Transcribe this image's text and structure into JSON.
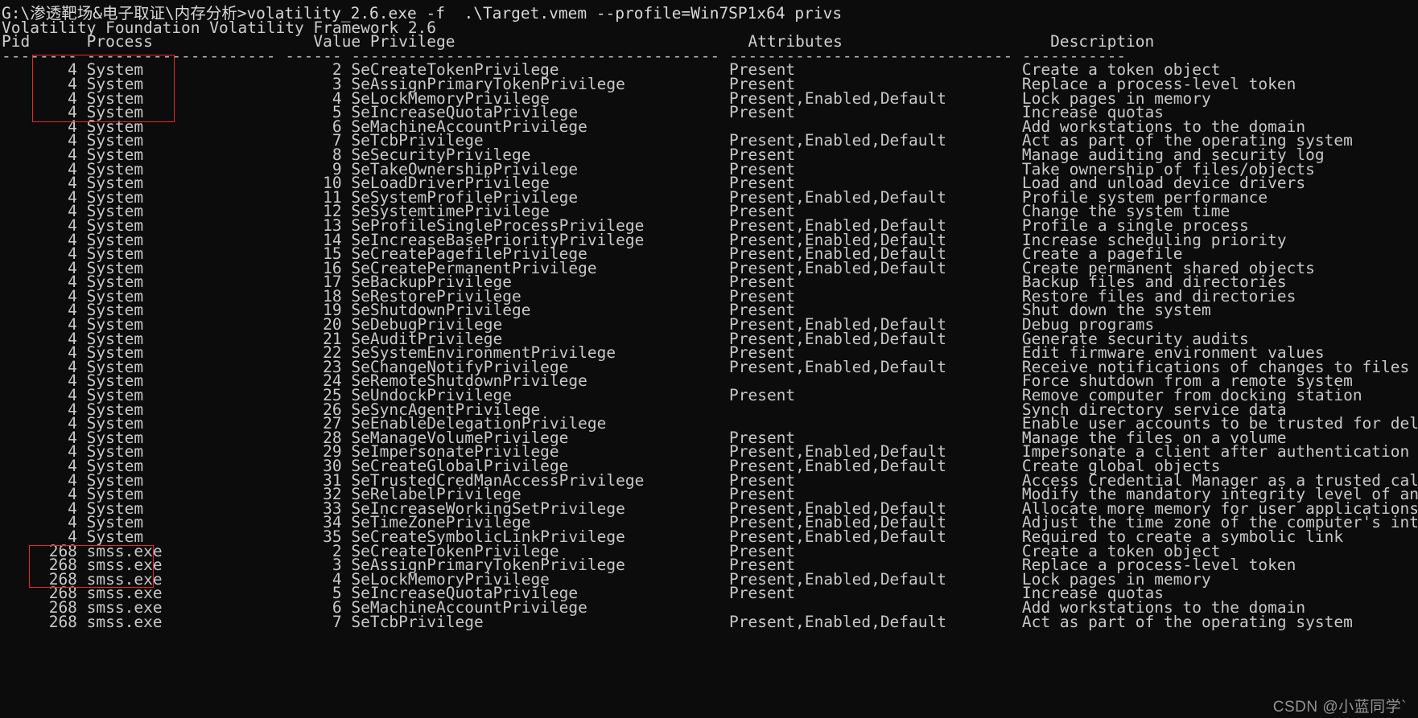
{
  "terminal": {
    "prompt_line": "G:\\渗透靶场&电子取证\\内存分析>volatility_2.6.exe -f  .\\Target.vmem --profile=Win7SP1x64 privs",
    "banner": "Volatility Foundation Volatility Framework 2.6",
    "header": "Pid      Process                 Value Privilege                               Attributes                      Description",
    "separator": "-------- -------------------- ------ --------------------------------------- ------------------------------ -----------",
    "background_color": "#0c0c0c",
    "text_color": "#cccccc",
    "annotation_color": "#e8282d",
    "watermark": "CSDN @小蓝同学`"
  },
  "columns": [
    "Pid",
    "Process",
    "Value",
    "Privilege",
    "Attributes",
    "Description"
  ],
  "rows": [
    {
      "pid": "4",
      "process": "System",
      "value": "2",
      "privilege": "SeCreateTokenPrivilege",
      "attributes": "Present",
      "description": "Create a token object"
    },
    {
      "pid": "4",
      "process": "System",
      "value": "3",
      "privilege": "SeAssignPrimaryTokenPrivilege",
      "attributes": "Present",
      "description": "Replace a process-level token"
    },
    {
      "pid": "4",
      "process": "System",
      "value": "4",
      "privilege": "SeLockMemoryPrivilege",
      "attributes": "Present,Enabled,Default",
      "description": "Lock pages in memory"
    },
    {
      "pid": "4",
      "process": "System",
      "value": "5",
      "privilege": "SeIncreaseQuotaPrivilege",
      "attributes": "Present",
      "description": "Increase quotas"
    },
    {
      "pid": "4",
      "process": "System",
      "value": "6",
      "privilege": "SeMachineAccountPrivilege",
      "attributes": "",
      "description": "Add workstations to the domain"
    },
    {
      "pid": "4",
      "process": "System",
      "value": "7",
      "privilege": "SeTcbPrivilege",
      "attributes": "Present,Enabled,Default",
      "description": "Act as part of the operating system"
    },
    {
      "pid": "4",
      "process": "System",
      "value": "8",
      "privilege": "SeSecurityPrivilege",
      "attributes": "Present",
      "description": "Manage auditing and security log"
    },
    {
      "pid": "4",
      "process": "System",
      "value": "9",
      "privilege": "SeTakeOwnershipPrivilege",
      "attributes": "Present",
      "description": "Take ownership of files/objects"
    },
    {
      "pid": "4",
      "process": "System",
      "value": "10",
      "privilege": "SeLoadDriverPrivilege",
      "attributes": "Present",
      "description": "Load and unload device drivers"
    },
    {
      "pid": "4",
      "process": "System",
      "value": "11",
      "privilege": "SeSystemProfilePrivilege",
      "attributes": "Present,Enabled,Default",
      "description": "Profile system performance"
    },
    {
      "pid": "4",
      "process": "System",
      "value": "12",
      "privilege": "SeSystemtimePrivilege",
      "attributes": "Present",
      "description": "Change the system time"
    },
    {
      "pid": "4",
      "process": "System",
      "value": "13",
      "privilege": "SeProfileSingleProcessPrivilege",
      "attributes": "Present,Enabled,Default",
      "description": "Profile a single process"
    },
    {
      "pid": "4",
      "process": "System",
      "value": "14",
      "privilege": "SeIncreaseBasePriorityPrivilege",
      "attributes": "Present,Enabled,Default",
      "description": "Increase scheduling priority"
    },
    {
      "pid": "4",
      "process": "System",
      "value": "15",
      "privilege": "SeCreatePagefilePrivilege",
      "attributes": "Present,Enabled,Default",
      "description": "Create a pagefile"
    },
    {
      "pid": "4",
      "process": "System",
      "value": "16",
      "privilege": "SeCreatePermanentPrivilege",
      "attributes": "Present,Enabled,Default",
      "description": "Create permanent shared objects"
    },
    {
      "pid": "4",
      "process": "System",
      "value": "17",
      "privilege": "SeBackupPrivilege",
      "attributes": "Present",
      "description": "Backup files and directories"
    },
    {
      "pid": "4",
      "process": "System",
      "value": "18",
      "privilege": "SeRestorePrivilege",
      "attributes": "Present",
      "description": "Restore files and directories"
    },
    {
      "pid": "4",
      "process": "System",
      "value": "19",
      "privilege": "SeShutdownPrivilege",
      "attributes": "Present",
      "description": "Shut down the system"
    },
    {
      "pid": "4",
      "process": "System",
      "value": "20",
      "privilege": "SeDebugPrivilege",
      "attributes": "Present,Enabled,Default",
      "description": "Debug programs"
    },
    {
      "pid": "4",
      "process": "System",
      "value": "21",
      "privilege": "SeAuditPrivilege",
      "attributes": "Present,Enabled,Default",
      "description": "Generate security audits"
    },
    {
      "pid": "4",
      "process": "System",
      "value": "22",
      "privilege": "SeSystemEnvironmentPrivilege",
      "attributes": "Present",
      "description": "Edit firmware environment values"
    },
    {
      "pid": "4",
      "process": "System",
      "value": "23",
      "privilege": "SeChangeNotifyPrivilege",
      "attributes": "Present,Enabled,Default",
      "description": "Receive notifications of changes to files or directories"
    },
    {
      "pid": "4",
      "process": "System",
      "value": "24",
      "privilege": "SeRemoteShutdownPrivilege",
      "attributes": "",
      "description": "Force shutdown from a remote system"
    },
    {
      "pid": "4",
      "process": "System",
      "value": "25",
      "privilege": "SeUndockPrivilege",
      "attributes": "Present",
      "description": "Remove computer from docking station"
    },
    {
      "pid": "4",
      "process": "System",
      "value": "26",
      "privilege": "SeSyncAgentPrivilege",
      "attributes": "",
      "description": "Synch directory service data"
    },
    {
      "pid": "4",
      "process": "System",
      "value": "27",
      "privilege": "SeEnableDelegationPrivilege",
      "attributes": "",
      "description": "Enable user accounts to be trusted for delegation"
    },
    {
      "pid": "4",
      "process": "System",
      "value": "28",
      "privilege": "SeManageVolumePrivilege",
      "attributes": "Present",
      "description": "Manage the files on a volume"
    },
    {
      "pid": "4",
      "process": "System",
      "value": "29",
      "privilege": "SeImpersonatePrivilege",
      "attributes": "Present,Enabled,Default",
      "description": "Impersonate a client after authentication"
    },
    {
      "pid": "4",
      "process": "System",
      "value": "30",
      "privilege": "SeCreateGlobalPrivilege",
      "attributes": "Present,Enabled,Default",
      "description": "Create global objects"
    },
    {
      "pid": "4",
      "process": "System",
      "value": "31",
      "privilege": "SeTrustedCredManAccessPrivilege",
      "attributes": "Present",
      "description": "Access Credential Manager as a trusted caller"
    },
    {
      "pid": "4",
      "process": "System",
      "value": "32",
      "privilege": "SeRelabelPrivilege",
      "attributes": "Present",
      "description": "Modify the mandatory integrity level of an object"
    },
    {
      "pid": "4",
      "process": "System",
      "value": "33",
      "privilege": "SeIncreaseWorkingSetPrivilege",
      "attributes": "Present,Enabled,Default",
      "description": "Allocate more memory for user applications"
    },
    {
      "pid": "4",
      "process": "System",
      "value": "34",
      "privilege": "SeTimeZonePrivilege",
      "attributes": "Present,Enabled,Default",
      "description": "Adjust the time zone of the computer's internal clock"
    },
    {
      "pid": "4",
      "process": "System",
      "value": "35",
      "privilege": "SeCreateSymbolicLinkPrivilege",
      "attributes": "Present,Enabled,Default",
      "description": "Required to create a symbolic link"
    },
    {
      "pid": "268",
      "process": "smss.exe",
      "value": "2",
      "privilege": "SeCreateTokenPrivilege",
      "attributes": "Present",
      "description": "Create a token object"
    },
    {
      "pid": "268",
      "process": "smss.exe",
      "value": "3",
      "privilege": "SeAssignPrimaryTokenPrivilege",
      "attributes": "Present",
      "description": "Replace a process-level token"
    },
    {
      "pid": "268",
      "process": "smss.exe",
      "value": "4",
      "privilege": "SeLockMemoryPrivilege",
      "attributes": "Present,Enabled,Default",
      "description": "Lock pages in memory"
    },
    {
      "pid": "268",
      "process": "smss.exe",
      "value": "5",
      "privilege": "SeIncreaseQuotaPrivilege",
      "attributes": "Present",
      "description": "Increase quotas"
    },
    {
      "pid": "268",
      "process": "smss.exe",
      "value": "6",
      "privilege": "SeMachineAccountPrivilege",
      "attributes": "",
      "description": "Add workstations to the domain"
    },
    {
      "pid": "268",
      "process": "smss.exe",
      "value": "7",
      "privilege": "SeTcbPrivilege",
      "attributes": "Present,Enabled,Default",
      "description": "Act as part of the operating system"
    }
  ],
  "annotations": [
    {
      "name": "system-rows-highlight",
      "label": ""
    },
    {
      "name": "smss-rows-highlight",
      "label": ""
    }
  ]
}
